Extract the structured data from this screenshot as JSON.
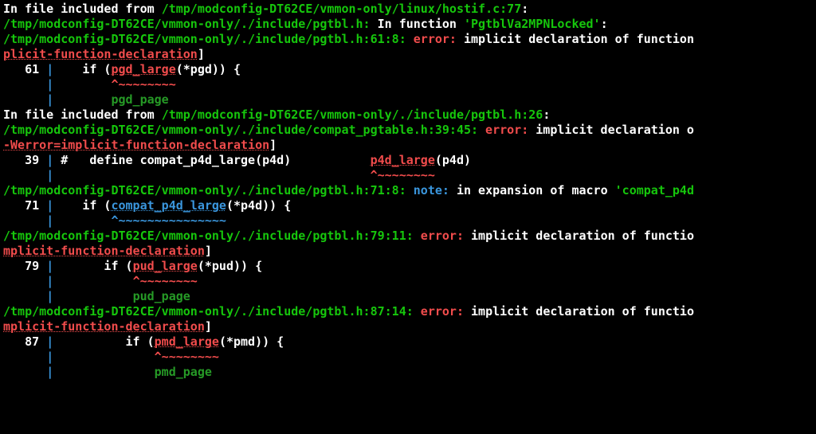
{
  "lines": {
    "l01_a": "In file included from ",
    "l01_b": "/tmp/modconfig-DT62CE/vmmon-only/linux/hostif.c:77",
    "l01_c": ":",
    "l02_a": "/tmp/modconfig-DT62CE/vmmon-only/./include/pgtbl.h:",
    "l02_b": " In function ",
    "l02_c": "'PgtblVa2MPNLocked'",
    "l02_d": ":",
    "l03_a": "/tmp/modconfig-DT62CE/vmmon-only/./include/pgtbl.h:61:8:",
    "l03_b": " error: ",
    "l03_c": "implicit declaration of function",
    "l04_a": "plicit-function-declaration",
    "l04_b": "]",
    "l05_a": "   61 ",
    "l05_b": "|",
    "l05_c": "    if (",
    "l05_d": "pgd_large",
    "l05_e": "(*pgd)) {",
    "l06_a": "      ",
    "l06_b": "|",
    "l06_c": "        ",
    "l06_d": "^~~~~~~~~",
    "l07_a": "      ",
    "l07_b": "|",
    "l07_c": "        ",
    "l07_d": "pgd_page",
    "l08_a": "In file included from ",
    "l08_b": "/tmp/modconfig-DT62CE/vmmon-only/./include/pgtbl.h:26",
    "l08_c": ":",
    "l09_a": "/tmp/modconfig-DT62CE/vmmon-only/./include/compat_pgtable.h:39:45:",
    "l09_b": " error: ",
    "l09_c": "implicit declaration o",
    "l10_a": "-Werror=implicit-function-declaration",
    "l10_b": "]",
    "l11_a": "   39 ",
    "l11_b": "|",
    "l11_c": " #   define compat_p4d_large(p4d)           ",
    "l11_d": "p4d_large",
    "l11_e": "(p4d)",
    "l12_a": "      ",
    "l12_b": "|",
    "l12_c": "                                            ",
    "l12_d": "^~~~~~~~~",
    "l13_a": "/tmp/modconfig-DT62CE/vmmon-only/./include/pgtbl.h:71:8:",
    "l13_b": " note: ",
    "l13_c": "in expansion of macro ",
    "l13_d": "'compat_p4d",
    "l14_a": "   71 ",
    "l14_b": "|",
    "l14_c": "    if (",
    "l14_d": "compat_p4d_large",
    "l14_e": "(*p4d)) {",
    "l15_a": "      ",
    "l15_b": "|",
    "l15_c": "        ",
    "l15_d": "^~~~~~~~~~~~~~~~",
    "l16_a": "/tmp/modconfig-DT62CE/vmmon-only/./include/pgtbl.h:79:11:",
    "l16_b": " error: ",
    "l16_c": "implicit declaration of functio",
    "l17_a": "mplicit-function-declaration",
    "l17_b": "]",
    "l18_a": "   79 ",
    "l18_b": "|",
    "l18_c": "       if (",
    "l18_d": "pud_large",
    "l18_e": "(*pud)) {",
    "l19_a": "      ",
    "l19_b": "|",
    "l19_c": "           ",
    "l19_d": "^~~~~~~~~",
    "l20_a": "      ",
    "l20_b": "|",
    "l20_c": "           ",
    "l20_d": "pud_page",
    "l21_a": "/tmp/modconfig-DT62CE/vmmon-only/./include/pgtbl.h:87:14:",
    "l21_b": " error: ",
    "l21_c": "implicit declaration of functio",
    "l22_a": "mplicit-function-declaration",
    "l22_b": "]",
    "l23_a": "   87 ",
    "l23_b": "|",
    "l23_c": "          if (",
    "l23_d": "pmd_large",
    "l23_e": "(*pmd)) {",
    "l24_a": "      ",
    "l24_b": "|",
    "l24_c": "              ",
    "l24_d": "^~~~~~~~~",
    "l25_a": "      ",
    "l25_b": "|",
    "l25_c": "              ",
    "l25_d": "pmd_page"
  }
}
